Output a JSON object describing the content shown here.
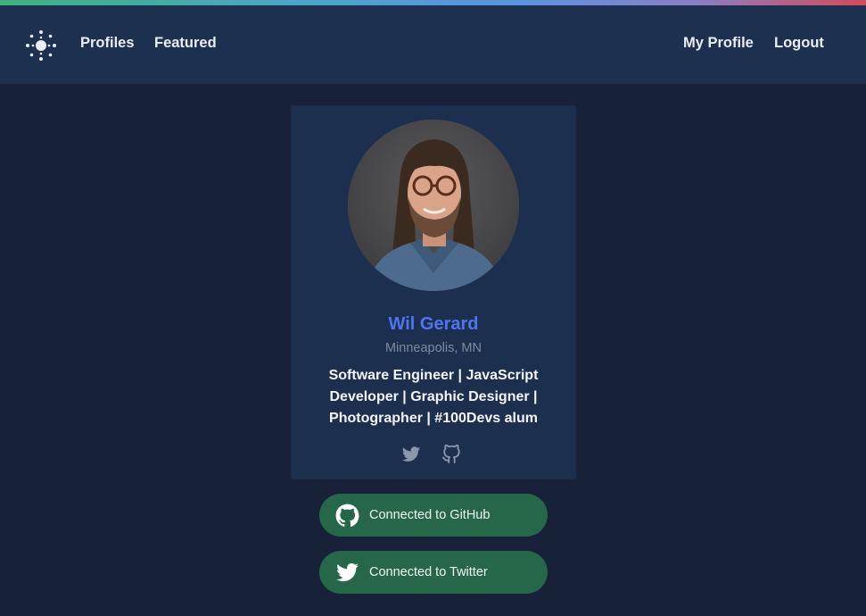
{
  "nav": {
    "logo_icon": "sparkle-logo-icon",
    "links_left": [
      "Profiles",
      "Featured"
    ],
    "links_right": [
      "My Profile",
      "Logout"
    ]
  },
  "profile": {
    "name": "Wil Gerard",
    "location": "Minneapolis, MN",
    "bio": "Software Engineer | JavaScript Developer | Graphic Designer | Photographer | #100Devs alum",
    "social_icons": [
      "twitter-icon",
      "github-icon"
    ]
  },
  "connections": [
    {
      "icon": "github-icon",
      "label": "Connected to GitHub"
    },
    {
      "icon": "twitter-icon",
      "label": "Connected to Twitter"
    }
  ],
  "colors": {
    "page_bg": "#172239",
    "navbar_bg": "#1e3050",
    "card_bg": "#1d2f4f",
    "name_accent": "#4f74f2",
    "connect_button": "#26674a"
  }
}
